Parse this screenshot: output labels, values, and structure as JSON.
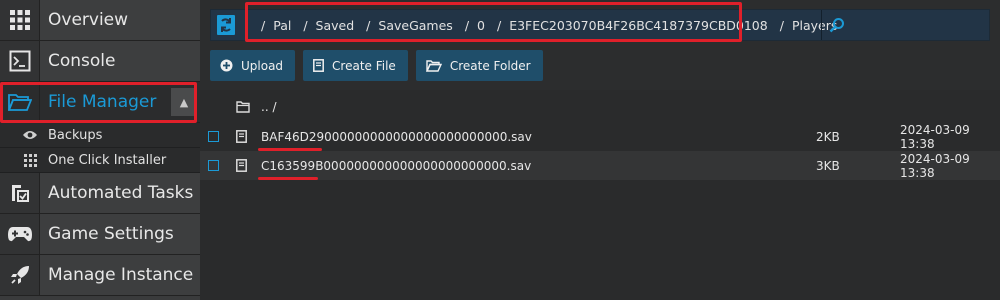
{
  "sidebar": {
    "items": [
      {
        "label": "Overview",
        "icon": "grid-icon"
      },
      {
        "label": "Console",
        "icon": "terminal-icon"
      },
      {
        "label": "File Manager",
        "icon": "folder-open-icon",
        "active": true
      },
      {
        "label": "Automated Tasks",
        "icon": "tasks-icon"
      },
      {
        "label": "Game Settings",
        "icon": "gamepad-icon"
      },
      {
        "label": "Manage Instance",
        "icon": "rocket-icon"
      }
    ],
    "subitems": [
      {
        "label": "Backups",
        "icon": "eye-icon"
      },
      {
        "label": "One Click Installer",
        "icon": "grid-small-icon"
      }
    ]
  },
  "pathbar": {
    "crumbs": [
      "/",
      "Pal",
      "/",
      "Saved",
      "/",
      "SaveGames",
      "/",
      "0",
      "/",
      "E3FEC203070B4F26BC4187379CBD0108",
      "/",
      "Players"
    ],
    "search_placeholder": ""
  },
  "actions": {
    "upload": "Upload",
    "create_file": "Create File",
    "create_folder": "Create Folder"
  },
  "files": {
    "parent": ".. /",
    "rows": [
      {
        "name": "BAF46D29000000000000000000000000.sav",
        "size": "2KB",
        "date": "2024-03-09 13:38"
      },
      {
        "name": "C163599B000000000000000000000000.sav",
        "size": "3KB",
        "date": "2024-03-09 13:38"
      }
    ]
  },
  "colors": {
    "accent": "#1b9ad6",
    "highlight": "#e0202a",
    "button": "#1f4e6a"
  }
}
